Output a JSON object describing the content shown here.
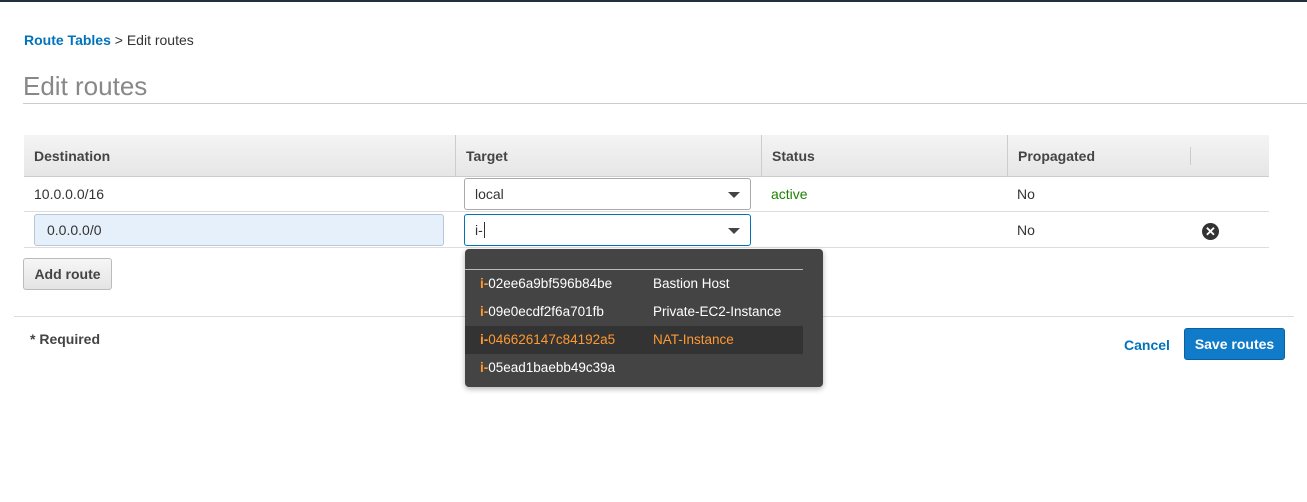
{
  "breadcrumb": {
    "link": "Route Tables",
    "separator": " > ",
    "current": "Edit routes"
  },
  "title": "Edit routes",
  "table": {
    "headers": [
      "Destination",
      "Target",
      "Status",
      "Propagated",
      ""
    ],
    "rows": [
      {
        "destination": "10.0.0.0/16",
        "target": "local",
        "status": "active",
        "propagated": "No"
      },
      {
        "destination": "0.0.0.0/0",
        "target": "i-",
        "status": "",
        "propagated": "No"
      }
    ]
  },
  "dropdown": {
    "items": [
      {
        "prefix": "i-",
        "id": "02ee6a9bf596b84be",
        "name": "Bastion Host"
      },
      {
        "prefix": "i-",
        "id": "09e0ecdf2f6a701fb",
        "name": "Private-EC2-Instance"
      },
      {
        "prefix": "i-",
        "id": "046626147c84192a5",
        "name": "NAT-Instance"
      },
      {
        "prefix": "i-",
        "id": "05ead1baebb49c39a",
        "name": ""
      }
    ]
  },
  "buttons": {
    "add_route": "Add route",
    "cancel": "Cancel",
    "save": "Save routes"
  },
  "required_note": "* Required",
  "colors": {
    "accent": "#0073bb",
    "active": "#1d8102",
    "highlight": "#ff9933"
  }
}
